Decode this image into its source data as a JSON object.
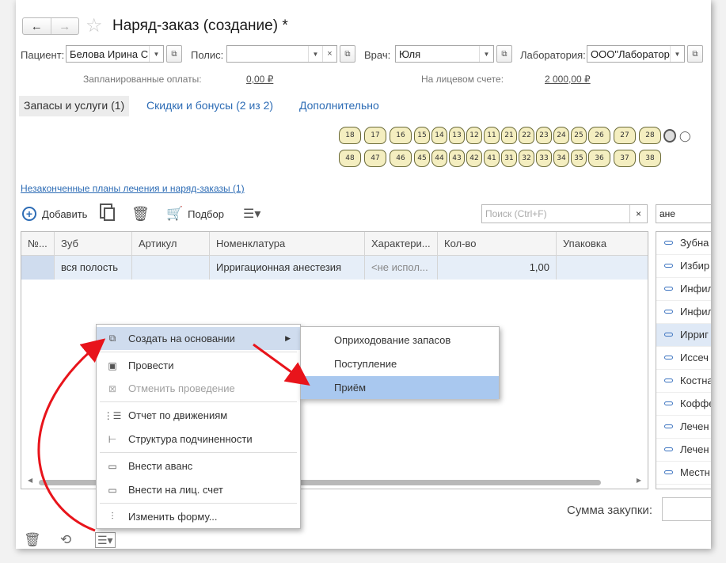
{
  "header": {
    "title": "Наряд-заказ (создание) *",
    "back_icon": "←",
    "forward_icon": "→"
  },
  "fields": {
    "patient_label": "Пациент:",
    "patient_value": "Белова Ирина С",
    "policy_label": "Полис:",
    "policy_value": "",
    "doctor_label": "Врач:",
    "doctor_value": "Юля",
    "lab_label": "Лаборатория:",
    "lab_value": "ООО\"Лаборатор"
  },
  "payments": {
    "planned_label": "Запланированные оплаты:",
    "planned_value": "0,00 ₽",
    "account_label": "На лицевом счете:",
    "account_value": "2 000,00 ₽"
  },
  "tabs": [
    {
      "label": "Запасы и услуги (1)",
      "active": true
    },
    {
      "label": "Скидки и бонусы (2 из 2)",
      "active": false
    },
    {
      "label": "Дополнительно",
      "active": false
    }
  ],
  "teeth_upper": [
    "18",
    "17",
    "16",
    "15",
    "14",
    "13",
    "12",
    "11",
    "21",
    "22",
    "23",
    "24",
    "25",
    "26",
    "27",
    "28"
  ],
  "teeth_lower": [
    "48",
    "47",
    "46",
    "45",
    "44",
    "43",
    "42",
    "41",
    "31",
    "32",
    "33",
    "34",
    "35",
    "36",
    "37",
    "38"
  ],
  "plans_link": "Незаконченные планы лечения и наряд-заказы (1)",
  "toolbar": {
    "add_label": "Добавить",
    "selection_label": "Подбор",
    "search_placeholder": "Поиск (Ctrl+F)",
    "search_clear": "×",
    "filter_value": "ане"
  },
  "table": {
    "columns": [
      "№...",
      "Зуб",
      "Артикул",
      "Номенклатура",
      "Характери...",
      "Кол-во",
      "Упаковка"
    ],
    "rows": [
      [
        "",
        "вся полость",
        "",
        "Ирригационная анестезия",
        "<не испол...",
        "1,00",
        ""
      ]
    ]
  },
  "right_list": [
    "Зубна",
    "Избир",
    "Инфил",
    "Инфил",
    "Ирриг",
    "Иссеч",
    "Костна",
    "Коффе",
    "Лечен",
    "Лечен",
    "Местн"
  ],
  "right_list_selected": 4,
  "sum": {
    "label": "Сумма закупки:",
    "value": ""
  },
  "context_menu": {
    "items": [
      {
        "label": "Создать на основании",
        "icon": "create-based-icon",
        "highlighted": true,
        "disabled": false,
        "submenu": true
      },
      {
        "label": "Провести",
        "icon": "post-icon",
        "highlighted": false,
        "disabled": false
      },
      {
        "label": "Отменить проведение",
        "icon": "unpost-icon",
        "highlighted": false,
        "disabled": true
      },
      {
        "label": "Отчет по движениям",
        "icon": "movements-report-icon",
        "highlighted": false,
        "disabled": false
      },
      {
        "label": "Структура подчиненности",
        "icon": "structure-icon",
        "highlighted": false,
        "disabled": false
      },
      {
        "label": "Внести аванс",
        "icon": "card-icon",
        "highlighted": false,
        "disabled": false
      },
      {
        "label": "Внести на лиц. счет",
        "icon": "card-icon",
        "highlighted": false,
        "disabled": false
      },
      {
        "label": "Изменить форму...",
        "icon": "settings-icon",
        "highlighted": false,
        "disabled": false
      }
    ]
  },
  "submenu": {
    "items": [
      {
        "label": "Оприходование запасов",
        "highlighted": false
      },
      {
        "label": "Поступление",
        "highlighted": false
      },
      {
        "label": "Приём",
        "highlighted": true
      }
    ]
  },
  "colors": {
    "accent": "#2d6cb5",
    "annotation_arrow": "#e8141b",
    "selection": "#a9c8ef",
    "tooth_fill": "#f4eec0"
  }
}
